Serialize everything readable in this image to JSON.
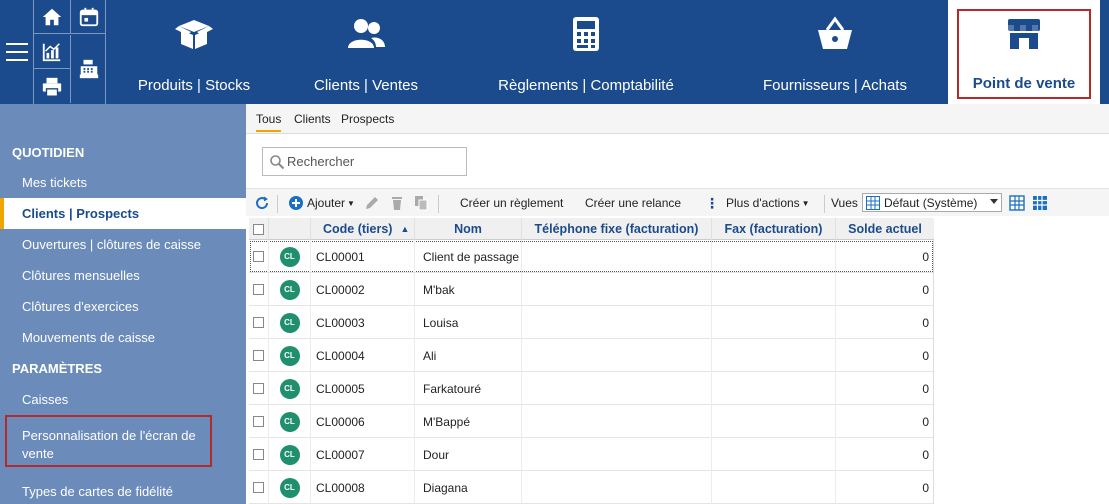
{
  "modules": [
    {
      "label": "Produits | Stocks",
      "icon": "open-box-icon"
    },
    {
      "label": "Clients | Ventes",
      "icon": "users-icon"
    },
    {
      "label": "Règlements | Comptabilité",
      "icon": "calculator-icon"
    },
    {
      "label": "Fournisseurs | Achats",
      "icon": "basket-icon"
    },
    {
      "label": "Point de vente",
      "icon": "storefront-icon",
      "active": true
    }
  ],
  "shortcuts": [
    "home-icon",
    "calendar-icon",
    "chart-icon",
    "cash-register-icon",
    "printer-icon"
  ],
  "sidebar": {
    "section_daily": "QUOTIDIEN",
    "section_settings": "PARAMÈTRES",
    "items": [
      "Mes tickets",
      "Clients | Prospects",
      "Ouvertures | clôtures de caisse",
      "Clôtures mensuelles",
      "Clôtures d'exercices",
      "Mouvements de caisse",
      "Caisses",
      "Personnalisation de l'écran de vente",
      "Types de cartes de fidélité"
    ],
    "active_item": "Clients | Prospects"
  },
  "tabs": [
    "Tous",
    "Clients",
    "Prospects"
  ],
  "search": {
    "placeholder": "Rechercher"
  },
  "toolbar": {
    "add": "Ajouter",
    "create_payment": "Créer un règlement",
    "create_reminder": "Créer une relance",
    "more_actions": "Plus d'actions",
    "views_label": "Vues",
    "view_selected": "Défaut (Système)"
  },
  "grid": {
    "columns": [
      "Code (tiers)",
      "Nom",
      "Téléphone fixe (facturation)",
      "Fax (facturation)",
      "Solde actuel"
    ],
    "rows": [
      {
        "badge": "CL",
        "code": "CL00001",
        "name": "Client de passage",
        "phone": "",
        "fax": "",
        "balance": "0"
      },
      {
        "badge": "CL",
        "code": "CL00002",
        "name": "M'bak",
        "phone": "",
        "fax": "",
        "balance": "0"
      },
      {
        "badge": "CL",
        "code": "CL00003",
        "name": "Louisa",
        "phone": "",
        "fax": "",
        "balance": "0"
      },
      {
        "badge": "CL",
        "code": "CL00004",
        "name": "Ali",
        "phone": "",
        "fax": "",
        "balance": "0"
      },
      {
        "badge": "CL",
        "code": "CL00005",
        "name": "Farkatouré",
        "phone": "",
        "fax": "",
        "balance": "0"
      },
      {
        "badge": "CL",
        "code": "CL00006",
        "name": "M'Bappé",
        "phone": "",
        "fax": "",
        "balance": "0"
      },
      {
        "badge": "CL",
        "code": "CL00007",
        "name": "Dour",
        "phone": "",
        "fax": "",
        "balance": "0"
      },
      {
        "badge": "CL",
        "code": "CL00008",
        "name": "Diagana",
        "phone": "",
        "fax": "",
        "balance": "0"
      }
    ]
  },
  "colors": {
    "brand": "#1b4b8c",
    "sidebar": "#6b8bba",
    "accent": "#f0a500",
    "highlight_frame": "#b32a2a",
    "badge": "#1f8f6e"
  }
}
